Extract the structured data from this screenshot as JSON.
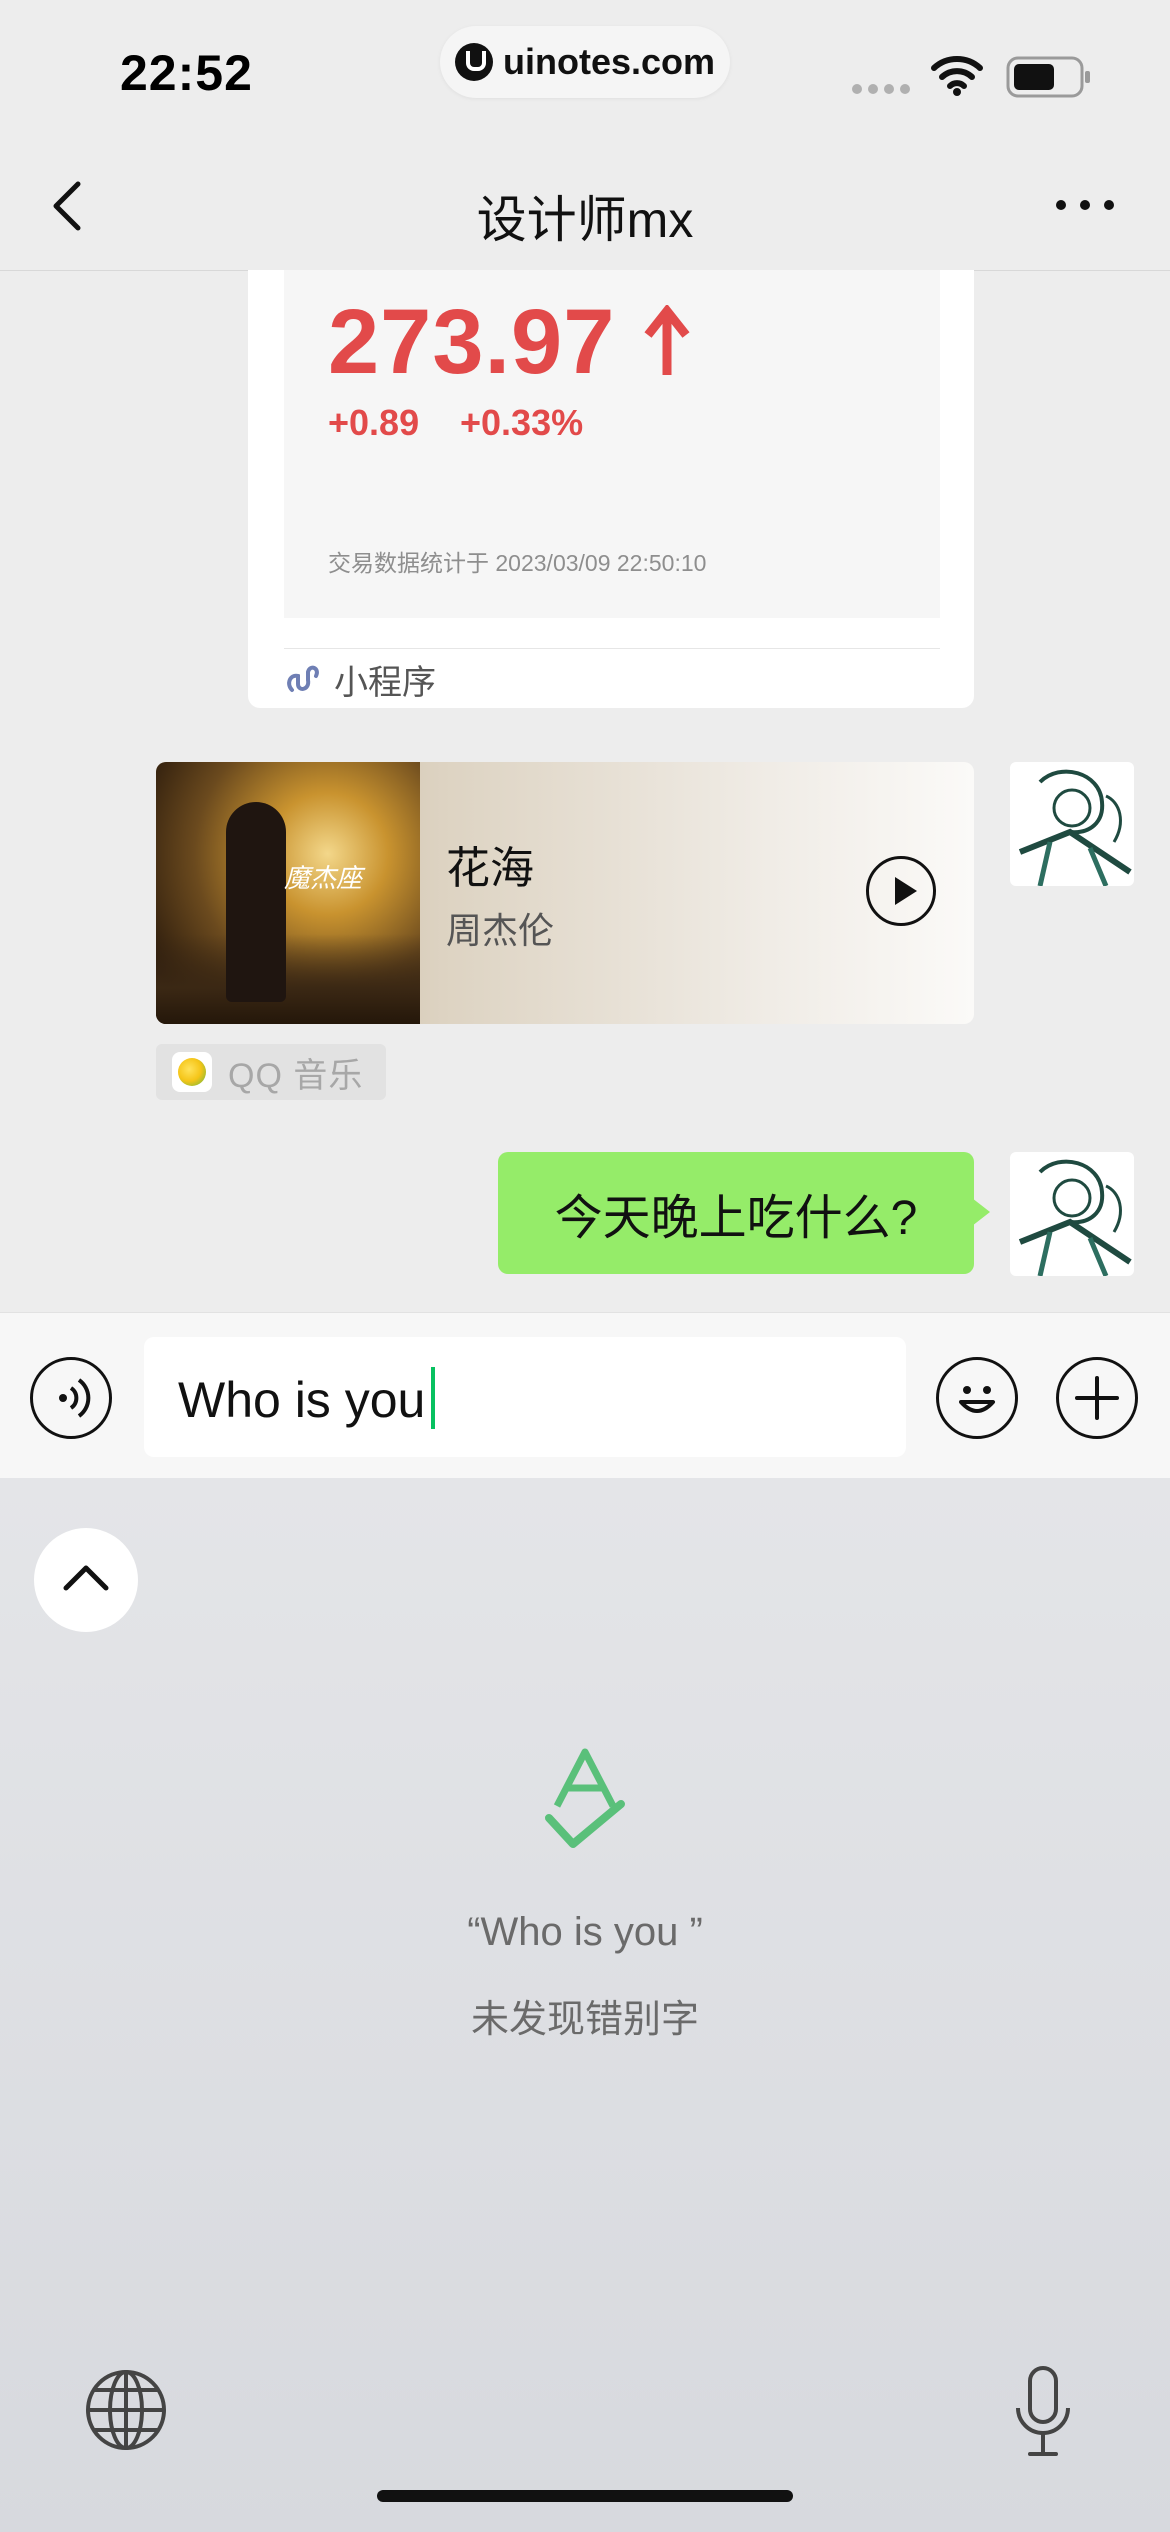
{
  "status_bar": {
    "time": "22:52",
    "watermark": "uinotes.com"
  },
  "nav": {
    "title": "设计师mx"
  },
  "mini_program": {
    "price": "273.97",
    "change": "+0.89",
    "change_pct": "+0.33%",
    "timestamp": "交易数据统计于 2023/03/09 22:50:10",
    "footer_label": "小程序"
  },
  "music": {
    "title": "花海",
    "artist": "周杰伦",
    "album_text": "魔杰座",
    "source": "QQ 音乐"
  },
  "message": {
    "text": "今天晚上吃什么?"
  },
  "input": {
    "value": "Who is you"
  },
  "spellcheck": {
    "word": "“Who is you ”",
    "result": "未发现错别字"
  },
  "colors": {
    "price_red": "#e24a4a",
    "bubble_green": "#95ec69",
    "accent_green": "#07c160",
    "check_green": "#5ac07a"
  }
}
